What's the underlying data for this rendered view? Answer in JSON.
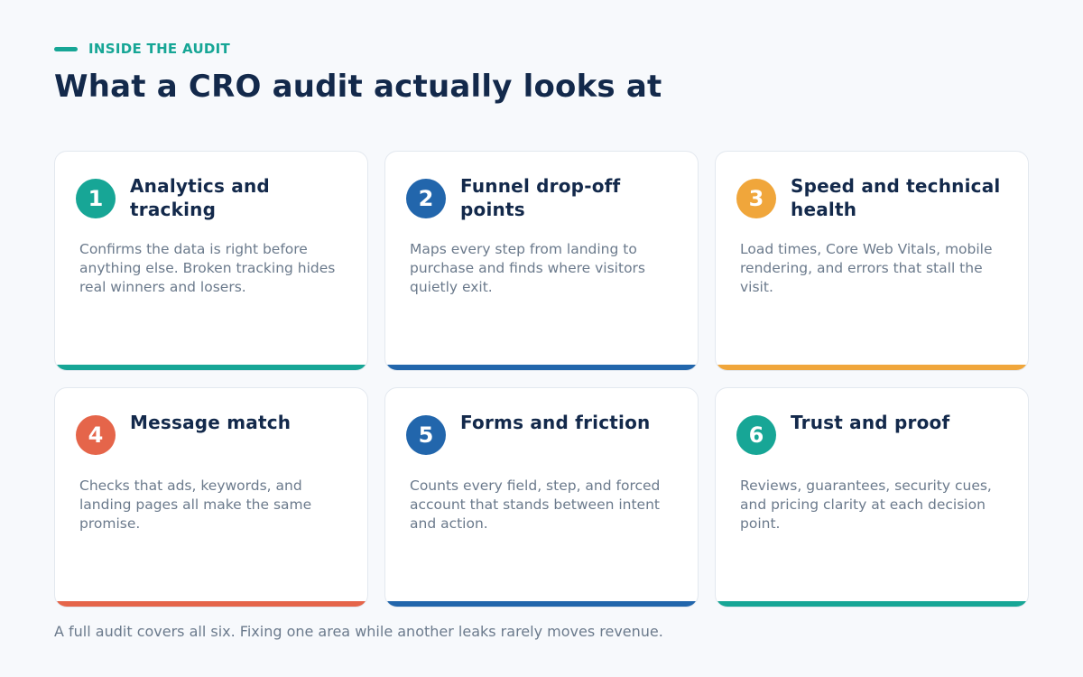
{
  "header": {
    "eyebrow": "INSIDE THE AUDIT",
    "title": "What a CRO audit actually looks at"
  },
  "cards": [
    {
      "number": "1",
      "title": "Analytics and tracking",
      "description": "Confirms the data is right before anything else. Broken tracking hides real winners and losers.",
      "color": "#17a696"
    },
    {
      "number": "2",
      "title": "Funnel drop-off points",
      "description": "Maps every step from landing to purchase and finds where visitors quietly exit.",
      "color": "#2266ac"
    },
    {
      "number": "3",
      "title": "Speed and technical health",
      "description": "Load times, Core Web Vitals, mobile rendering, and errors that stall the visit.",
      "color": "#f0a63b"
    },
    {
      "number": "4",
      "title": "Message match",
      "description": "Checks that ads, keywords, and landing pages all make the same promise.",
      "color": "#e5654a"
    },
    {
      "number": "5",
      "title": "Forms and friction",
      "description": "Counts every field, step, and forced account that stands between intent and action.",
      "color": "#2266ac"
    },
    {
      "number": "6",
      "title": "Trust and proof",
      "description": "Reviews, guarantees, security cues, and pricing clarity at each decision point.",
      "color": "#17a696"
    }
  ],
  "footer": "A full audit covers all six. Fixing one area while another leaks rarely moves revenue."
}
